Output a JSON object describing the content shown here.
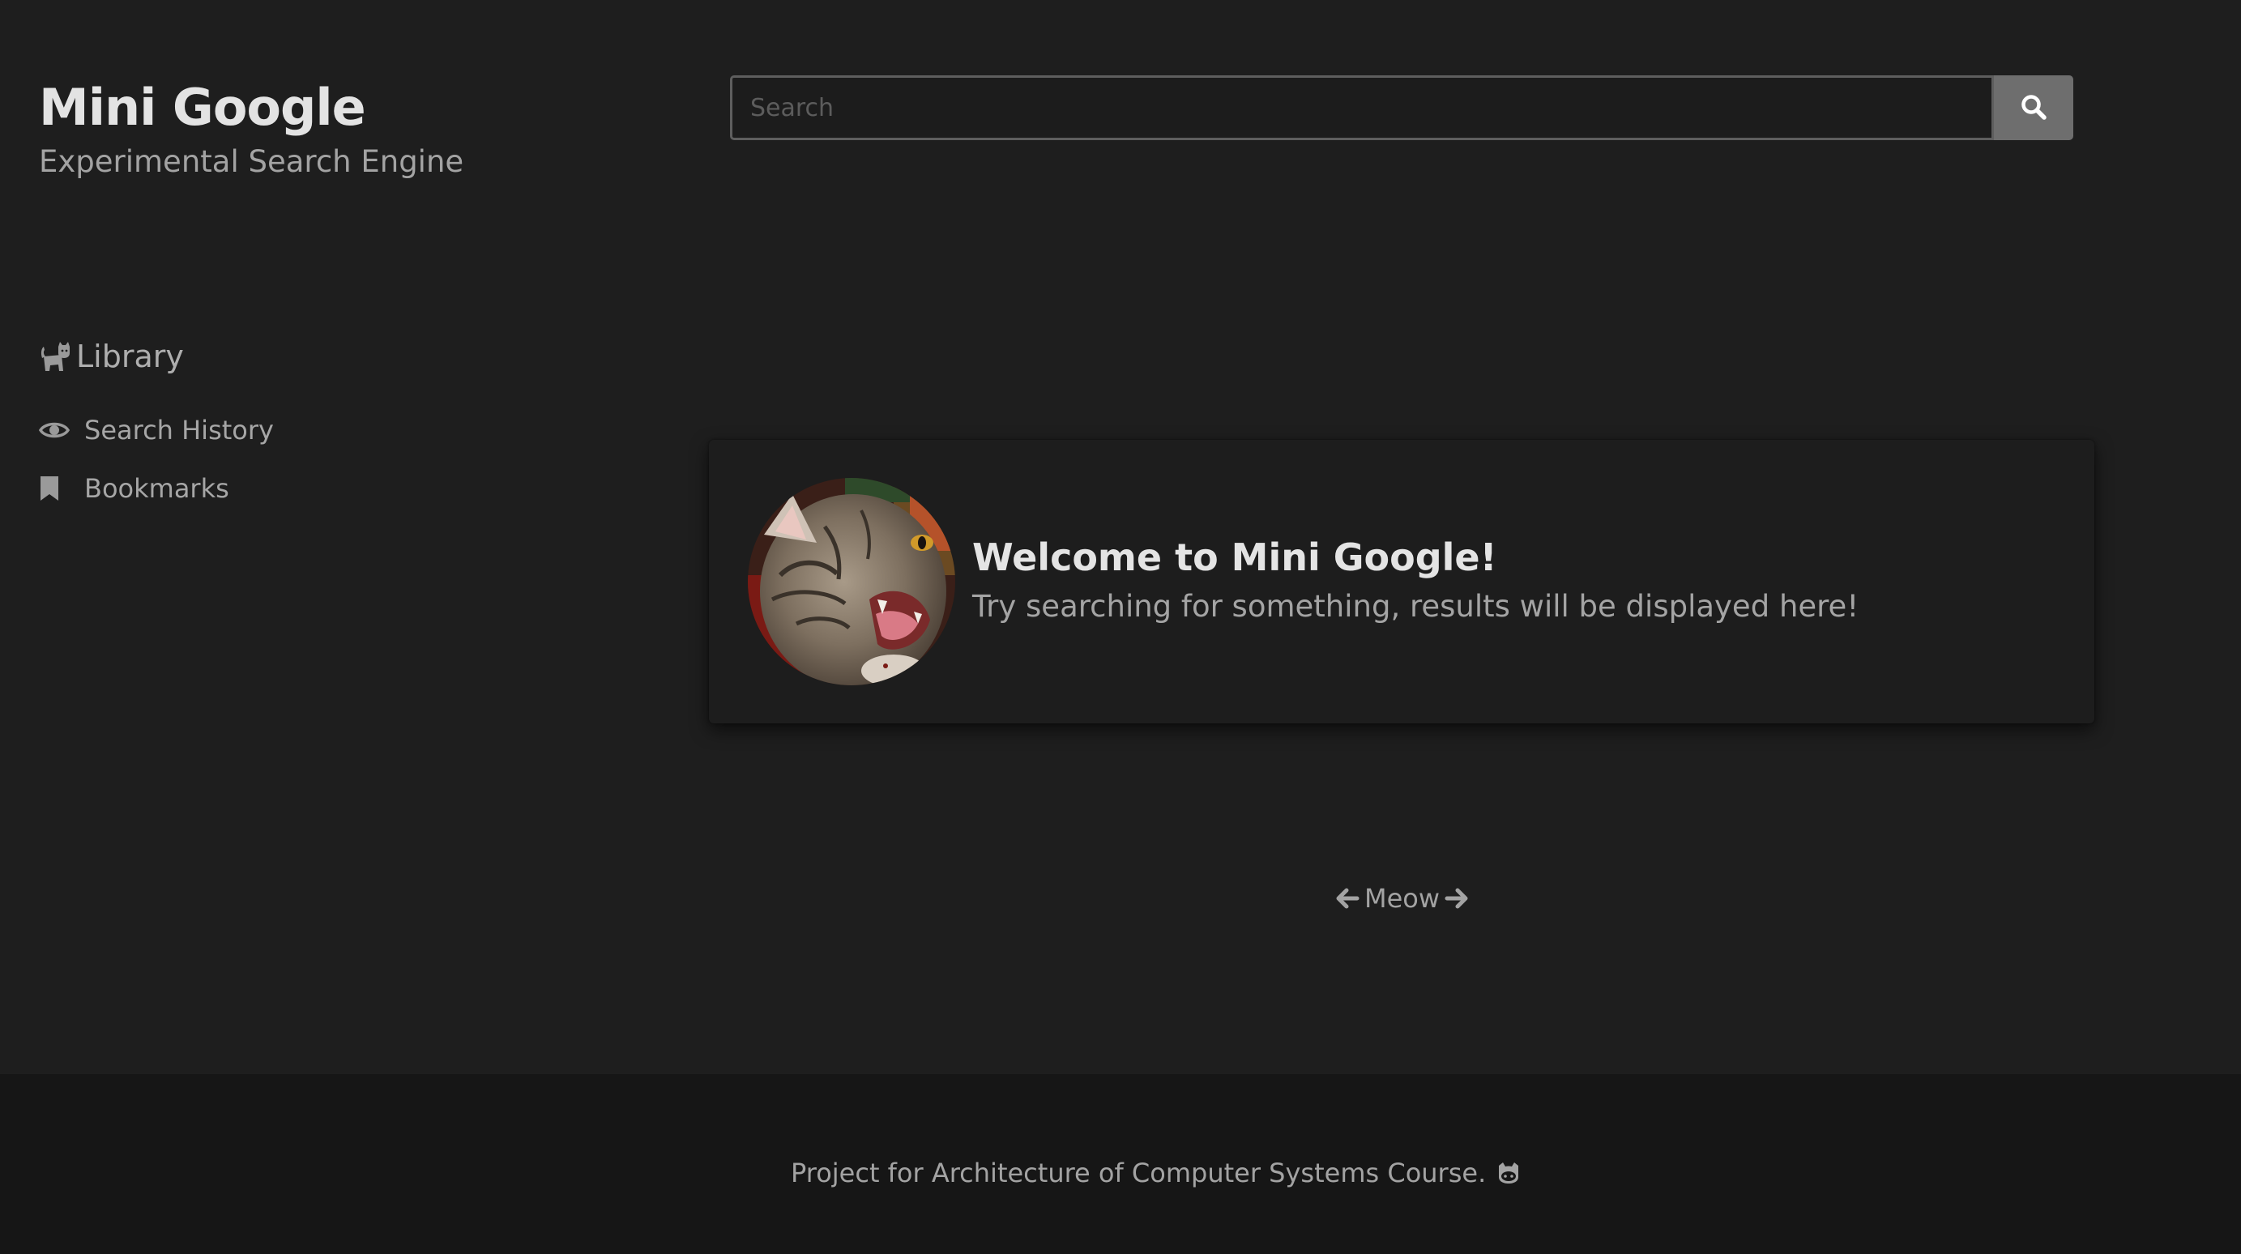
{
  "brand": {
    "title": "Mini Google",
    "subtitle": "Experimental Search Engine"
  },
  "search": {
    "placeholder": "Search",
    "value": "",
    "button_icon": "search-icon"
  },
  "sidebar": {
    "heading": {
      "label": "Library",
      "icon": "cat-icon"
    },
    "items": [
      {
        "label": "Search History",
        "icon": "eye-icon"
      },
      {
        "label": "Bookmarks",
        "icon": "bookmark-icon"
      }
    ]
  },
  "welcome_card": {
    "title": "Welcome to Mini Google!",
    "text": "Try searching for something, results will be displayed here!",
    "image": "yawning-cat-photo"
  },
  "pagination": {
    "label": "Meow",
    "prev_icon": "arrow-left-icon",
    "next_icon": "arrow-right-icon"
  },
  "footer": {
    "text": "Project for Architecture of Computer Systems Course.",
    "icon": "github-icon"
  },
  "colors": {
    "background": "#1e1e1e",
    "footer_background": "#161616",
    "search_button": "#6e6e6e",
    "text_primary": "#e3e3e3",
    "text_muted": "#a3a3a3"
  }
}
